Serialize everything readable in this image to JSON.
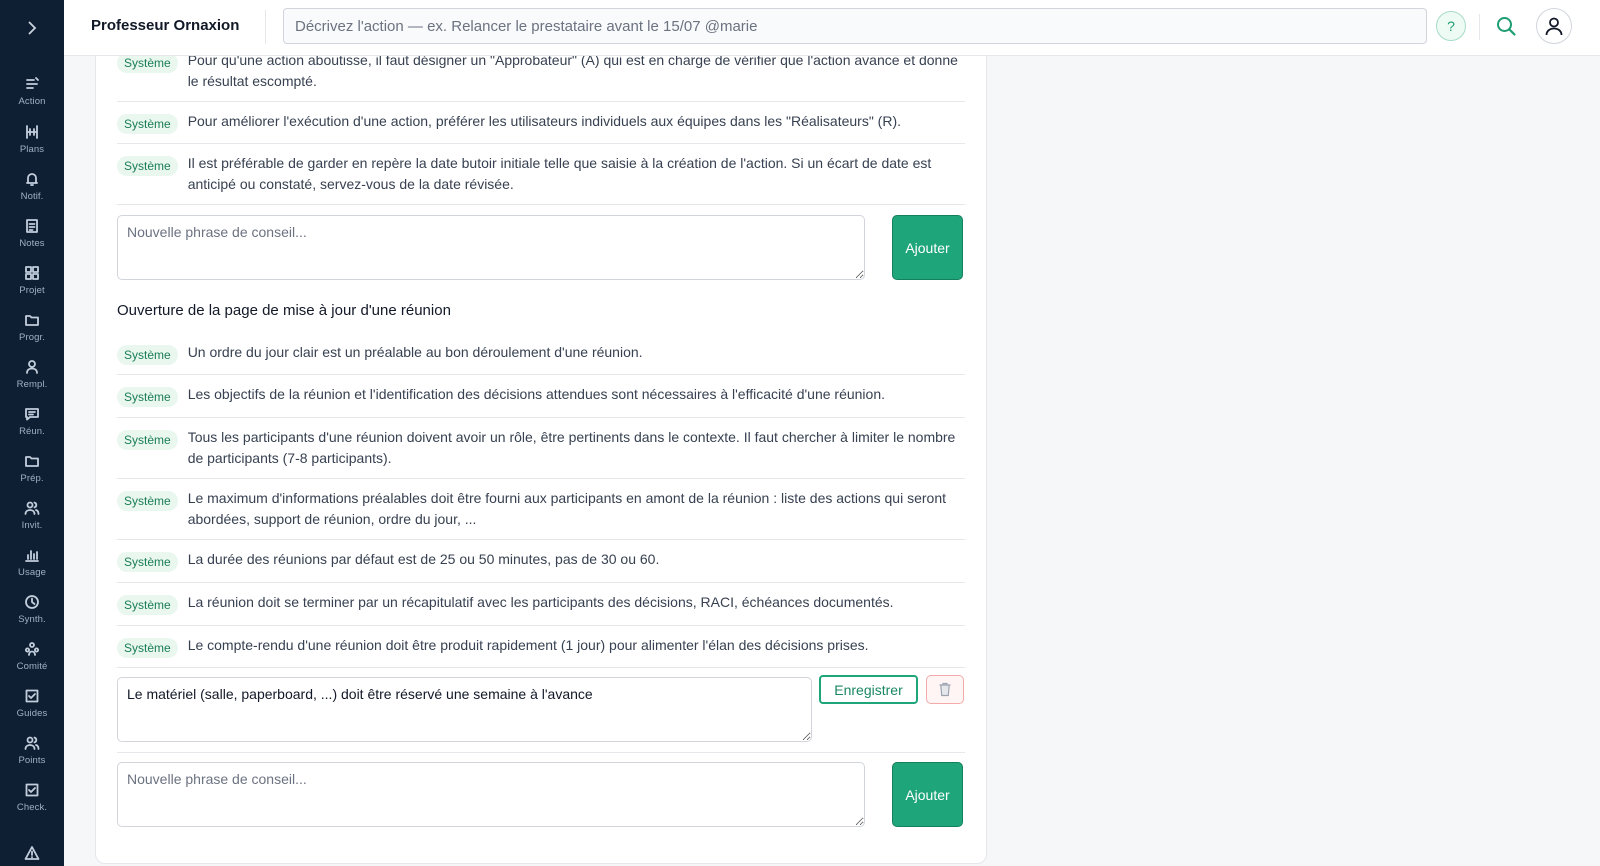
{
  "app": {
    "title": "Professeur Ornaxion"
  },
  "search": {
    "placeholder": "Décrivez l'action — ex. Relancer le prestataire avant le 15/07 @marie"
  },
  "header": {
    "help_label": "?"
  },
  "sidebar": {
    "toggle_icon": "chevron-right-icon",
    "items": [
      {
        "label": "Action",
        "icon": "action-icon"
      },
      {
        "label": "Plans",
        "icon": "plans-icon"
      },
      {
        "label": "Notif.",
        "icon": "bell-icon"
      },
      {
        "label": "Notes",
        "icon": "notes-icon"
      },
      {
        "label": "Projet",
        "icon": "grid-icon"
      },
      {
        "label": "Progr.",
        "icon": "folder-icon"
      },
      {
        "label": "Rempl.",
        "icon": "user-icon"
      },
      {
        "label": "Réun.",
        "icon": "chat-icon"
      },
      {
        "label": "Prép.",
        "icon": "folder-icon"
      },
      {
        "label": "Invit.",
        "icon": "users-icon"
      },
      {
        "label": "Usage",
        "icon": "bar-chart-icon"
      },
      {
        "label": "Synth.",
        "icon": "clock-icon"
      },
      {
        "label": "Comité",
        "icon": "committee-icon"
      },
      {
        "label": "Guides",
        "icon": "check-square-icon"
      },
      {
        "label": "Points",
        "icon": "users-icon"
      },
      {
        "label": "Check.",
        "icon": "check-square-icon"
      },
      {
        "label": "",
        "icon": "warning-icon"
      }
    ]
  },
  "badge_label": "Système",
  "section1": {
    "advices": [
      "Pour qu'une action aboutisse, il faut désigner un \"Approbateur\" (A) qui est en charge de vérifier que l'action avance et donne le résultat escompté.",
      "Pour améliorer l'exécution d'une action, préférer les utilisateurs individuels aux équipes dans les \"Réalisateurs\" (R).",
      "Il est préférable de garder en repère la date butoir initiale telle que saisie à la création de l'action. Si un écart de date est anticipé ou constaté, servez-vous de la date révisée."
    ],
    "new_placeholder": "Nouvelle phrase de conseil...",
    "add_label": "Ajouter"
  },
  "section2": {
    "title": "Ouverture de la page de mise à jour d'une réunion",
    "advices": [
      "Un ordre du jour clair est un préalable au bon déroulement d'une réunion.",
      "Les objectifs de la réunion et l'identification des décisions attendues sont nécessaires à l'efficacité d'une réunion.",
      "Tous les participants d'une réunion doivent avoir un rôle, être pertinents dans le contexte. Il faut chercher à limiter le nombre de participants (7-8 participants).",
      "Le maximum d'informations préalables doit être fourni aux participants en amont de la réunion : liste des actions qui seront abordées, support de réunion, ordre du jour, ...",
      "La durée des réunions par défaut est de 25 ou 50 minutes, pas de 30 ou 60.",
      "La réunion doit se terminer par un récapitulatif avec les participants des décisions, RACI, échéances documentés.",
      "Le compte-rendu d'une réunion doit être produit rapidement (1 jour) pour alimenter l'élan des décisions prises."
    ],
    "edit_value": "Le matériel (salle, paperboard, ...) doit être réservé une semaine à l'avance",
    "save_label": "Enregistrer",
    "delete_icon": "trash-icon",
    "new_placeholder": "Nouvelle phrase de conseil...",
    "add_label": "Ajouter"
  }
}
